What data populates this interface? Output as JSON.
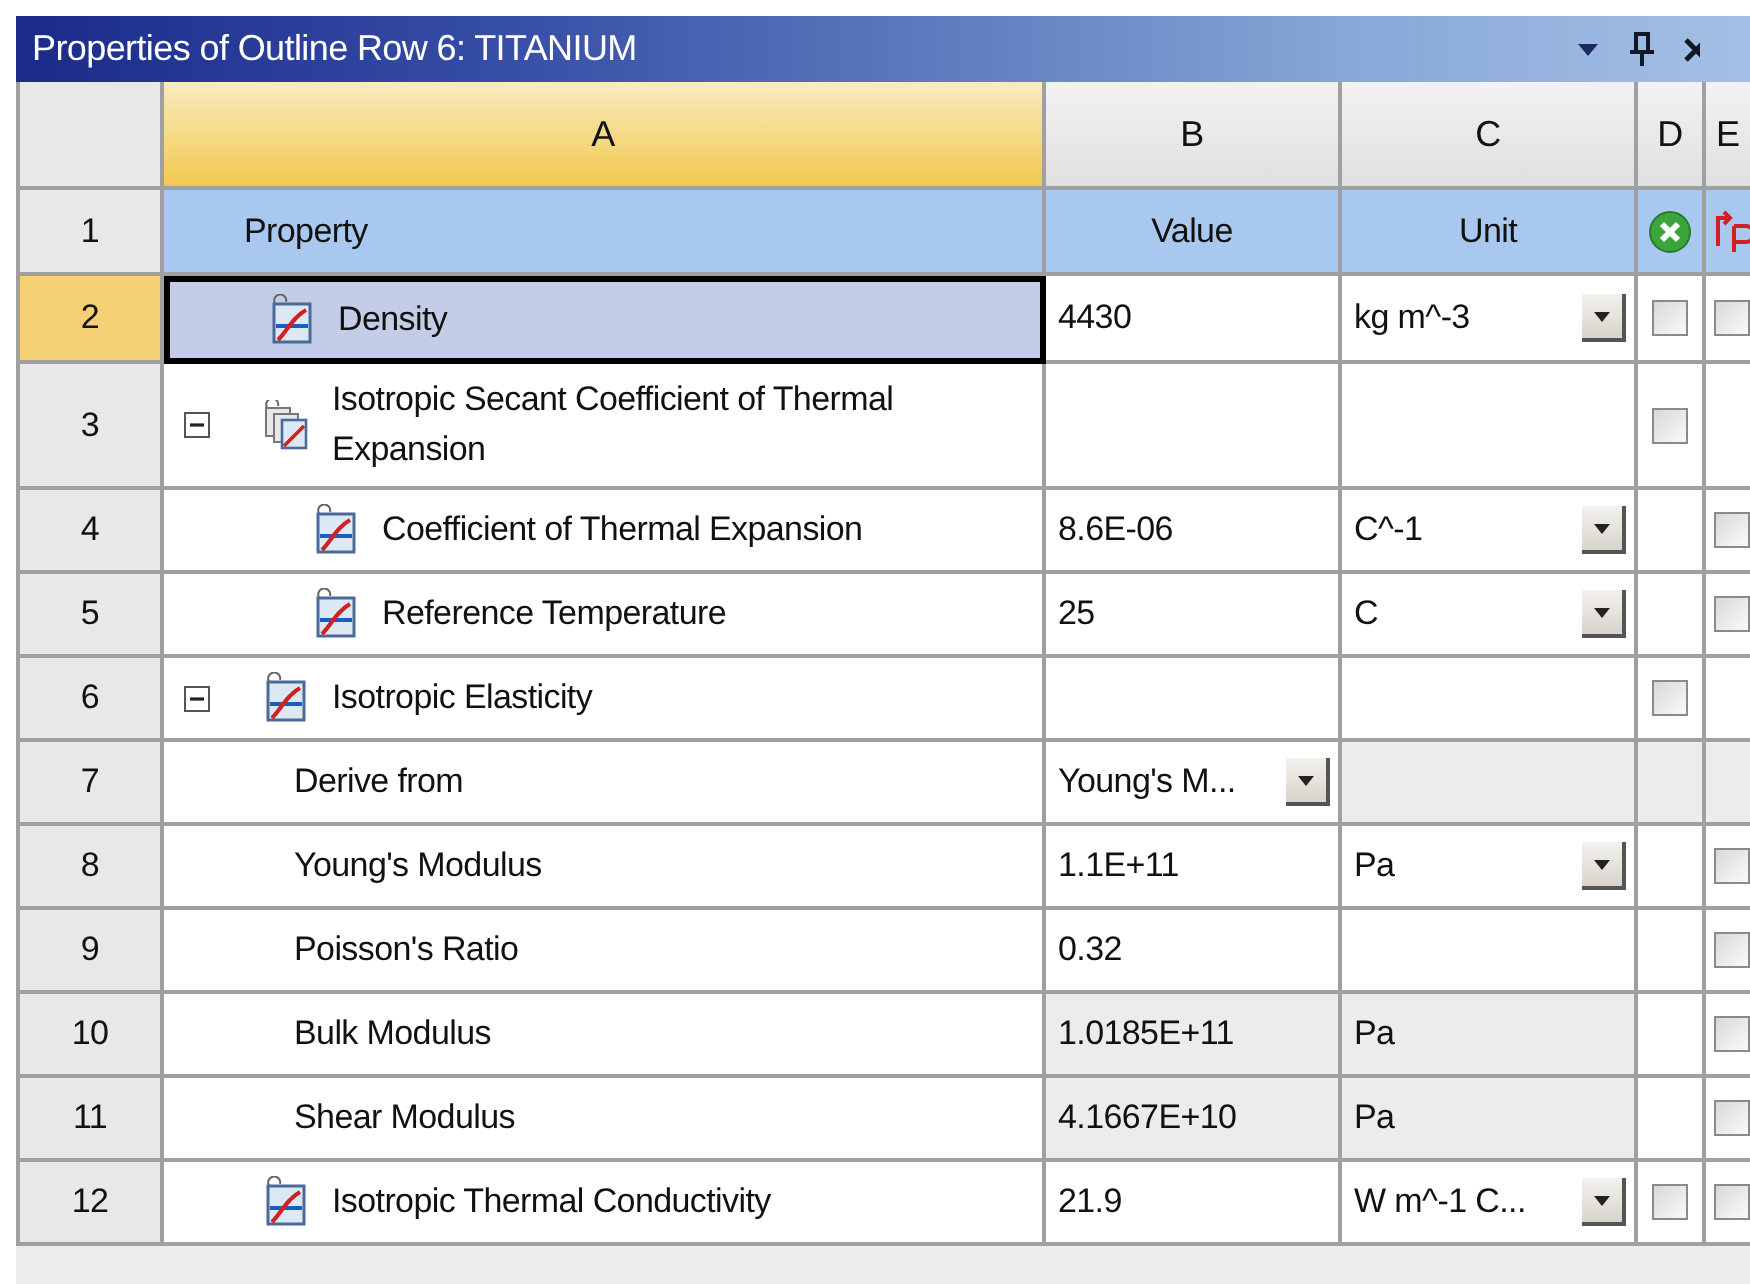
{
  "title": "Properties of Outline Row 6: TITANIUM",
  "columns": [
    {
      "label": "A",
      "selected": true
    },
    {
      "label": "B",
      "selected": false
    },
    {
      "label": "C",
      "selected": false
    },
    {
      "label": "D",
      "selected": false
    },
    {
      "label": "E",
      "selected": false
    }
  ],
  "header_row": {
    "number": "1",
    "property": "Property",
    "value": "Value",
    "unit": "Unit"
  },
  "rows": [
    {
      "number": "2",
      "kind": "chart",
      "selected": true,
      "property": "Density",
      "value": "4430",
      "unit": "kg m^-3",
      "unit_dropdown": true,
      "d_checkbox": {
        "checked": false
      },
      "e_checkbox": {
        "checked": false
      }
    },
    {
      "number": "3",
      "kind": "group",
      "selected": false,
      "expanded": true,
      "property": "Isotropic Secant Coefficient of Thermal Expansion",
      "d_checkbox": {
        "checked": false
      },
      "children": [
        {
          "number": "4",
          "kind": "chart",
          "selected": false,
          "property": "Coefficient of Thermal Expansion",
          "value": "8.6E-06",
          "unit": "C^-1",
          "unit_dropdown": true,
          "e_checkbox": {
            "checked": false
          }
        },
        {
          "number": "5",
          "kind": "chart",
          "selected": false,
          "property": "Reference Temperature",
          "value": "25",
          "unit": "C",
          "unit_dropdown": true,
          "e_checkbox": {
            "checked": false
          }
        }
      ]
    },
    {
      "number": "6",
      "kind": "chart",
      "selected": false,
      "expanded": true,
      "property": "Isotropic Elasticity",
      "d_checkbox": {
        "checked": false
      },
      "children": [
        {
          "number": "7",
          "kind": "option",
          "selected": false,
          "property": "Derive from",
          "value": "Young's M..."
        },
        {
          "number": "8",
          "kind": "field",
          "selected": false,
          "property": "Young's Modulus",
          "value": "1.1E+11",
          "unit": "Pa",
          "unit_dropdown": true,
          "e_checkbox": {
            "checked": false
          }
        },
        {
          "number": "9",
          "kind": "field",
          "selected": false,
          "property": "Poisson's Ratio",
          "value": "0.32",
          "e_checkbox": {
            "checked": false
          }
        },
        {
          "number": "10",
          "kind": "derived",
          "selected": false,
          "property": "Bulk Modulus",
          "value": "1.0185E+11",
          "unit": "Pa",
          "e_checkbox": {
            "checked": false
          }
        },
        {
          "number": "11",
          "kind": "derived",
          "selected": false,
          "property": "Shear Modulus",
          "value": "4.1667E+10",
          "unit": "Pa",
          "e_checkbox": {
            "checked": false
          }
        }
      ]
    },
    {
      "number": "12",
      "kind": "chart",
      "selected": false,
      "property": "Isotropic Thermal Conductivity",
      "value": "21.9",
      "unit": "W m^-1 C...",
      "unit_dropdown": true,
      "d_checkbox": {
        "checked": false
      },
      "e_checkbox": {
        "checked": false
      }
    }
  ]
}
